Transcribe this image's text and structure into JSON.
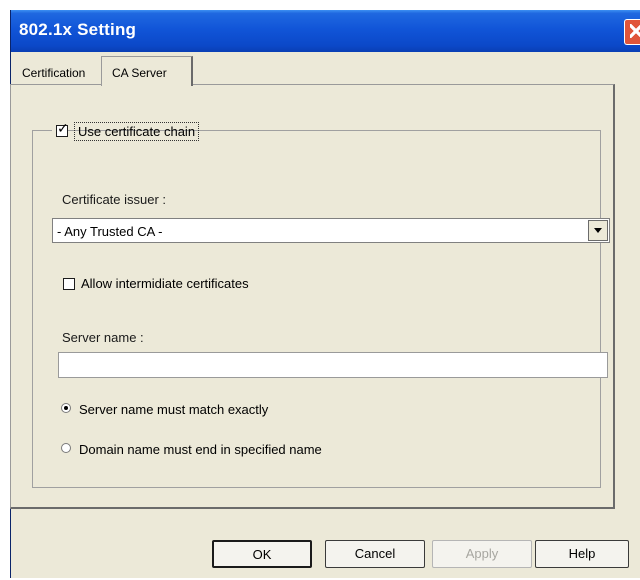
{
  "window": {
    "title": "802.1x Setting"
  },
  "tabs": [
    {
      "label": "Certification",
      "active": false
    },
    {
      "label": "CA Server",
      "active": true
    }
  ],
  "group": {
    "label": "Use certificate chain",
    "checked": true
  },
  "issuer": {
    "label": "Certificate issuer :",
    "selected": "- Any Trusted CA -"
  },
  "intermediate": {
    "label": "Allow intermidiate certificates",
    "checked": false
  },
  "server": {
    "label": "Server name :",
    "value": ""
  },
  "radios": [
    {
      "label": "Server name must match exactly",
      "selected": true
    },
    {
      "label": "Domain name must end in specified name",
      "selected": false
    }
  ],
  "buttons": {
    "ok": "OK",
    "cancel": "Cancel",
    "apply": "Apply",
    "help": "Help"
  },
  "colors": {
    "titlebar": "#0b48c8",
    "face": "#ece9d8",
    "close": "#e0553a"
  },
  "icons": {
    "close": "close-icon",
    "dropdown": "chevron-down-icon"
  }
}
